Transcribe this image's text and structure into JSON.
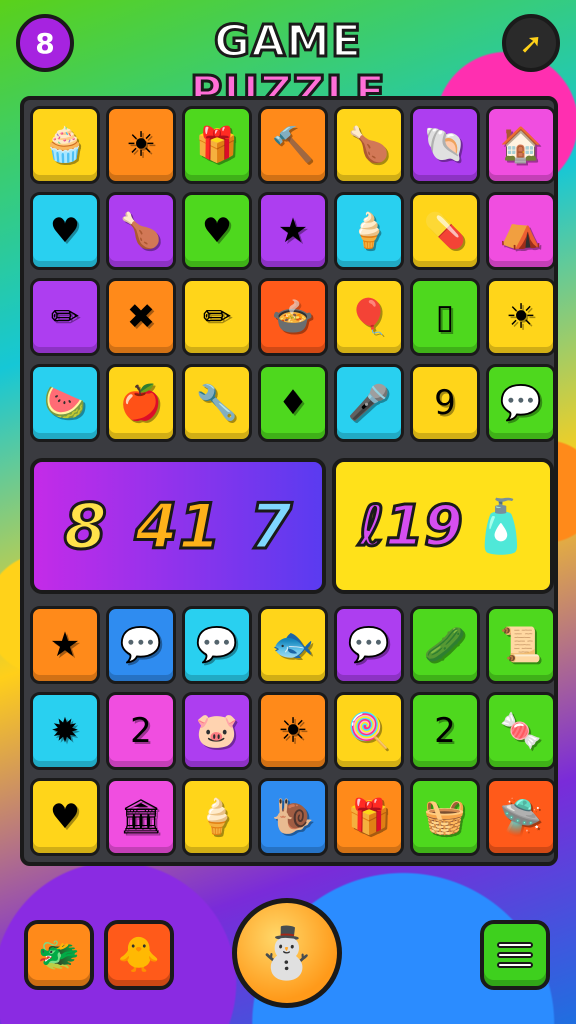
{
  "header": {
    "title_part1": "GAME",
    "title_part2": "PUZZLE",
    "left_button_icon": "settings-badge-icon",
    "left_button_glyph": "8",
    "right_button_icon": "cursor-arrow-icon",
    "right_button_glyph": "➚"
  },
  "board": {
    "rows": [
      [
        {
          "c": "Y",
          "i": "🧁"
        },
        {
          "c": "O",
          "i": "☀"
        },
        {
          "c": "G",
          "i": "🎁"
        },
        {
          "c": "O",
          "i": "🔨"
        },
        {
          "c": "Y",
          "i": "🍗"
        },
        {
          "c": "P",
          "i": "🐚"
        },
        {
          "c": "M",
          "i": "🏠"
        }
      ],
      [
        {
          "c": "C",
          "i": "♥"
        },
        {
          "c": "P",
          "i": "🍗"
        },
        {
          "c": "G",
          "i": "♥"
        },
        {
          "c": "P",
          "i": "★"
        },
        {
          "c": "C",
          "i": "🍦"
        },
        {
          "c": "Y",
          "i": "💊"
        },
        {
          "c": "M",
          "i": "⛺"
        }
      ],
      [
        {
          "c": "P",
          "i": "✏"
        },
        {
          "c": "O",
          "i": "✖"
        },
        {
          "c": "Y",
          "i": "✏"
        },
        {
          "c": "R",
          "i": "🍲"
        },
        {
          "c": "Y",
          "i": "🎈"
        },
        {
          "c": "G",
          "i": "▯"
        },
        {
          "c": "Y",
          "i": "☀"
        }
      ],
      [
        {
          "c": "C",
          "i": "🍉"
        },
        {
          "c": "Y",
          "i": "🍎"
        },
        {
          "c": "Y",
          "i": "🔧"
        },
        {
          "c": "G",
          "i": "♦"
        },
        {
          "c": "C",
          "i": "🎤"
        },
        {
          "c": "Y",
          "i": "9"
        },
        {
          "c": "G",
          "i": "💬"
        }
      ],
      [
        {
          "c": "O",
          "i": "★"
        },
        {
          "c": "B",
          "i": "💬"
        },
        {
          "c": "C",
          "i": "💬"
        },
        {
          "c": "Y",
          "i": "🐟"
        },
        {
          "c": "P",
          "i": "💬"
        },
        {
          "c": "G",
          "i": "🥒"
        },
        {
          "c": "G",
          "i": "📜"
        }
      ],
      [
        {
          "c": "C",
          "i": "✹"
        },
        {
          "c": "M",
          "i": "2"
        },
        {
          "c": "P",
          "i": "🐷"
        },
        {
          "c": "O",
          "i": "☀"
        },
        {
          "c": "Y",
          "i": "🍭"
        },
        {
          "c": "G",
          "i": "2"
        },
        {
          "c": "G",
          "i": "🍬"
        }
      ],
      [
        {
          "c": "Y",
          "i": "♥"
        },
        {
          "c": "M",
          "i": "🏛"
        },
        {
          "c": "Y",
          "i": "🍦"
        },
        {
          "c": "B",
          "i": "🐌"
        },
        {
          "c": "O",
          "i": "🎁"
        },
        {
          "c": "G",
          "i": "🧺"
        },
        {
          "c": "R",
          "i": "🛸"
        }
      ]
    ],
    "banner_left": {
      "n1": "8",
      "n2": "41",
      "n3": "7"
    },
    "banner_right": {
      "text": "ℓ19",
      "icon": "bottle-icon",
      "glyph": "🧴"
    }
  },
  "footer": {
    "left_item_1": "🐲",
    "left_item_2": "🐥",
    "center_button_glyph": "⛄",
    "menu_icon": "menu-icon"
  }
}
